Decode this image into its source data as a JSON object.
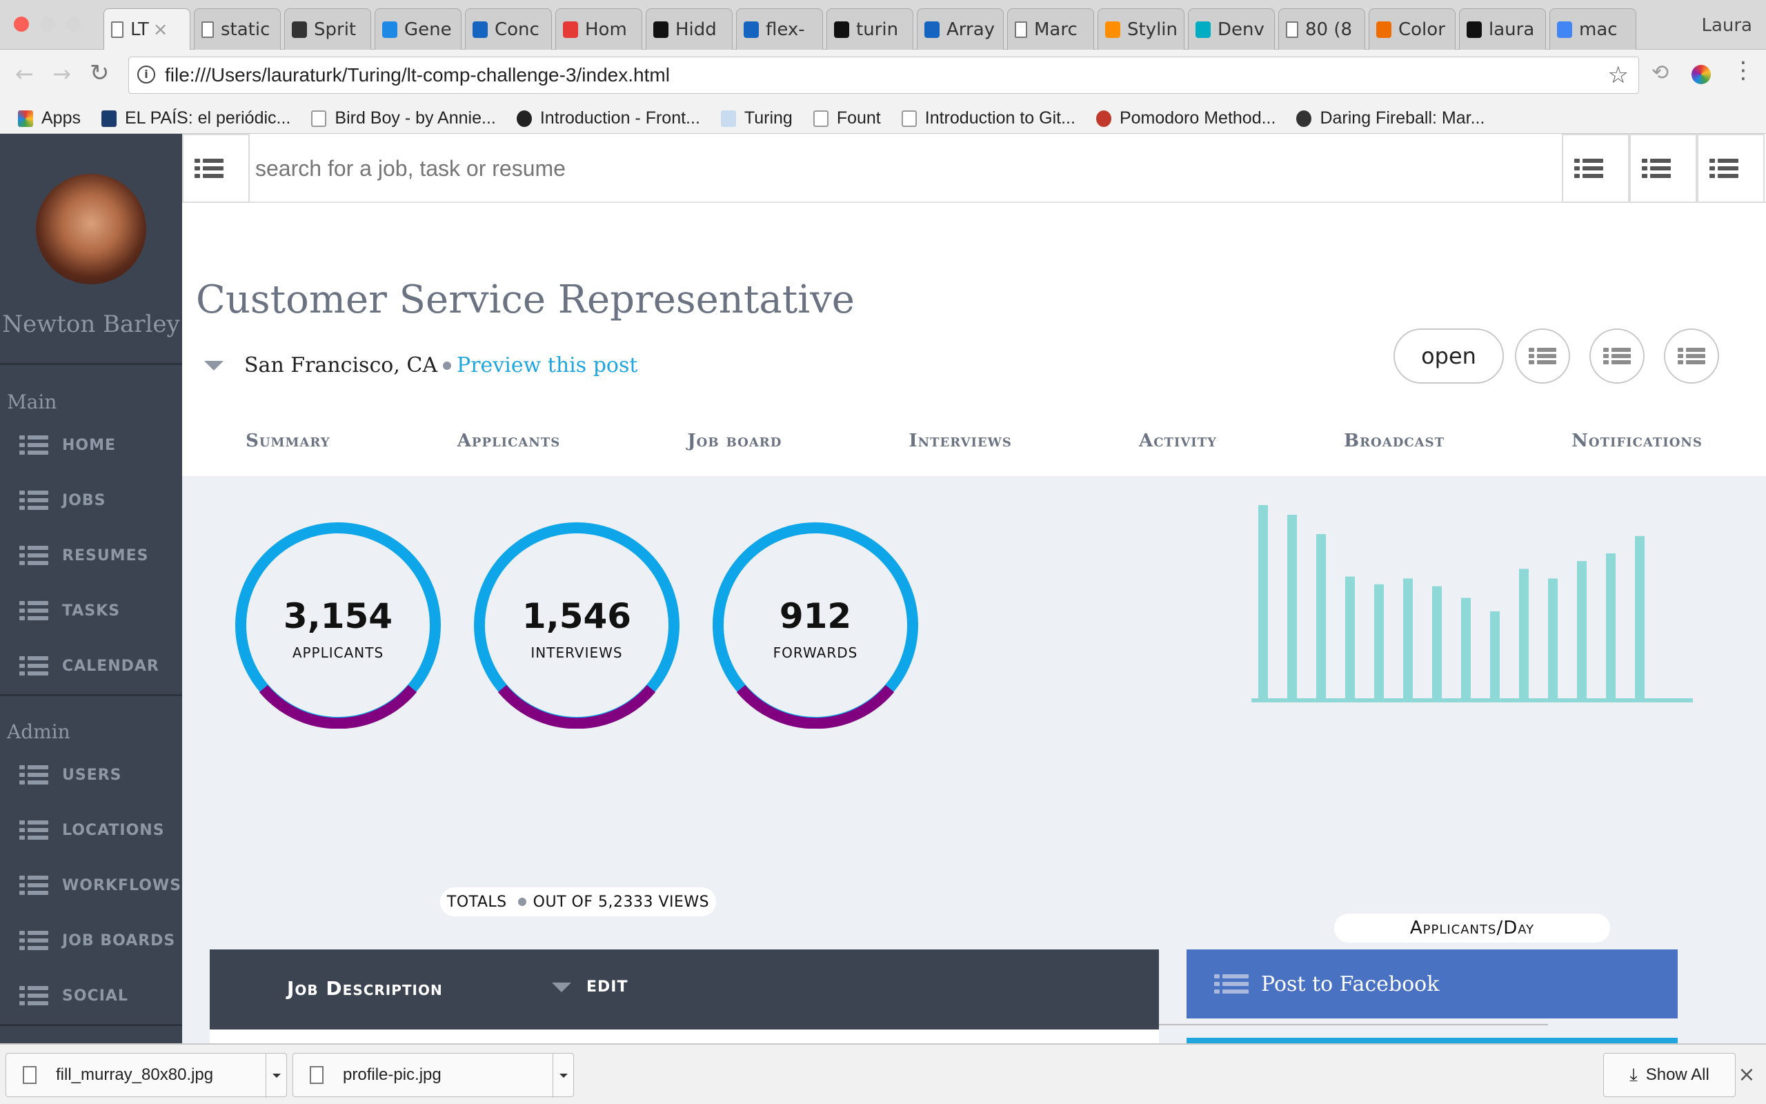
{
  "browser": {
    "tabs": [
      {
        "label": "LT",
        "active": true,
        "favicon": "document-icon"
      },
      {
        "label": "static",
        "favicon": "document-icon"
      },
      {
        "label": "Sprit",
        "favicon": "codepen-icon"
      },
      {
        "label": "Gene",
        "favicon": "circle-icon"
      },
      {
        "label": "Conc",
        "favicon": "mdn-icon"
      },
      {
        "label": "Hom",
        "favicon": "sketch-icon"
      },
      {
        "label": "Hidd",
        "favicon": "18f-icon"
      },
      {
        "label": "flex-",
        "favicon": "mdn-icon"
      },
      {
        "label": "turin",
        "favicon": "github-icon"
      },
      {
        "label": "Array",
        "favicon": "mdn-icon"
      },
      {
        "label": "Marc",
        "favicon": "document-icon"
      },
      {
        "label": "Stylin",
        "favicon": "asterisk-icon"
      },
      {
        "label": "Denv",
        "favicon": "square-icon"
      },
      {
        "label": "80 (8",
        "favicon": "document-icon"
      },
      {
        "label": "Color",
        "favicon": "orange-icon"
      },
      {
        "label": "laura",
        "favicon": "github-icon"
      },
      {
        "label": "mac",
        "favicon": "google-icon"
      }
    ],
    "profile_name": "Laura",
    "url": "file:///Users/lauraturk/Turing/lt-comp-challenge-3/index.html",
    "bookmarks": [
      {
        "label": "Apps",
        "icon": "apps-grid-icon"
      },
      {
        "label": "EL PAÍS: el periódic...",
        "icon": "elpais-icon"
      },
      {
        "label": "Bird Boy - by Annie...",
        "icon": "document-icon"
      },
      {
        "label": "Introduction - Front...",
        "icon": "turing-icon"
      },
      {
        "label": "Turing",
        "icon": "folder-icon"
      },
      {
        "label": "Fount",
        "icon": "document-icon"
      },
      {
        "label": "Introduction to Git...",
        "icon": "document-icon"
      },
      {
        "label": "Pomodoro Method...",
        "icon": "pomodoro-icon"
      },
      {
        "label": "Daring Fireball: Mar...",
        "icon": "star-icon"
      }
    ]
  },
  "sidebar": {
    "user_name": "Newton Barley",
    "main_section": "Main",
    "main_items": [
      "HOME",
      "JOBS",
      "RESUMES",
      "TASKS",
      "CALENDAR"
    ],
    "admin_section": "Admin",
    "admin_items": [
      "USERS",
      "LOCATIONS",
      "WORKFLOWS",
      "JOB BOARDS",
      "SOCIAL"
    ]
  },
  "search": {
    "placeholder": "search for a job, task or resume"
  },
  "job": {
    "title": "Customer Service Representative",
    "location": "San Francisco, CA",
    "preview_link": "Preview this post",
    "status": "open"
  },
  "tabs": [
    "Summary",
    "Applicants",
    "Job board",
    "Interviews",
    "Activity",
    "Broadcast",
    "Notifications"
  ],
  "stats": {
    "applicants": {
      "value": "3,154",
      "label": "APPLICANTS"
    },
    "interviews": {
      "value": "1,546",
      "label": "INTERVIEWS"
    },
    "forwards": {
      "value": "912",
      "label": "FORWARDS"
    },
    "totals_label": "TOTALS",
    "views_label": "OUT OF 5,2333 VIEWS"
  },
  "colors": {
    "ring_primary": "#0ea5e9",
    "ring_secondary": "#800080",
    "bar": "#8ed8d8",
    "sidebar": "#3d4451",
    "facebook": "#4a72c2"
  },
  "chart_data": {
    "type": "bar",
    "title": "Applicants/Day",
    "values": [
      100,
      95,
      85,
      63,
      59,
      62,
      58,
      52,
      45,
      67,
      62,
      71,
      75,
      84
    ],
    "ylim": [
      0,
      100
    ]
  },
  "job_description": {
    "label": "Job Description",
    "edit": "EDIT"
  },
  "facebook": {
    "label": "Post to Facebook"
  },
  "downloads": {
    "items": [
      "fill_murray_80x80.jpg",
      "profile-pic.jpg"
    ],
    "show_all": "Show All"
  }
}
